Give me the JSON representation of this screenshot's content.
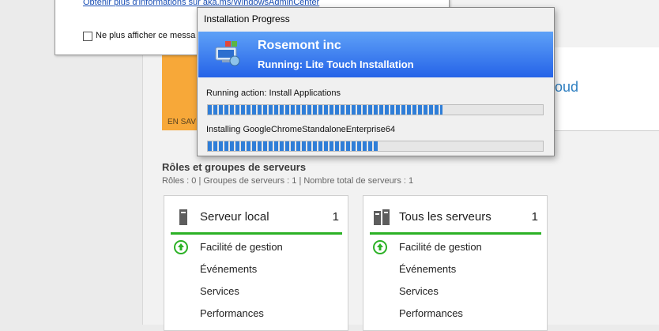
{
  "popup": {
    "link_text": "Obtenir plus d'informations sur aka.ms/WindowsAdminCenter",
    "checkbox_label": "Ne plus afficher ce messa"
  },
  "background": {
    "tile_text": "EN SAV",
    "panel_text": "loud"
  },
  "roles": {
    "title": "Rôles et groupes de serveurs",
    "summary": "Rôles : 0   |   Groupes de serveurs : 1   |   Nombre total de serveurs : 1"
  },
  "tiles": [
    {
      "title": "Serveur local",
      "count": "1",
      "icon": "server-icon",
      "rows": [
        "Facilité de gestion",
        "Événements",
        "Services",
        "Performances"
      ]
    },
    {
      "title": "Tous les serveurs",
      "count": "1",
      "icon": "servers-icon",
      "rows": [
        "Facilité de gestion",
        "Événements",
        "Services",
        "Performances"
      ]
    }
  ],
  "dialog": {
    "title": "Installation Progress",
    "org": "Rosemont inc",
    "status": "Running: Lite Touch Installation",
    "action_label": "Running action: Install Applications",
    "action_progress": 0.7,
    "install_label": "Installing GoogleChromeStandaloneEnterprise64",
    "install_progress": 0.51
  },
  "colors": {
    "accent_green": "#2cb126",
    "banner_blue": "#2563e8",
    "progress_blue": "#2f7ed8",
    "orange": "#f7a839"
  }
}
